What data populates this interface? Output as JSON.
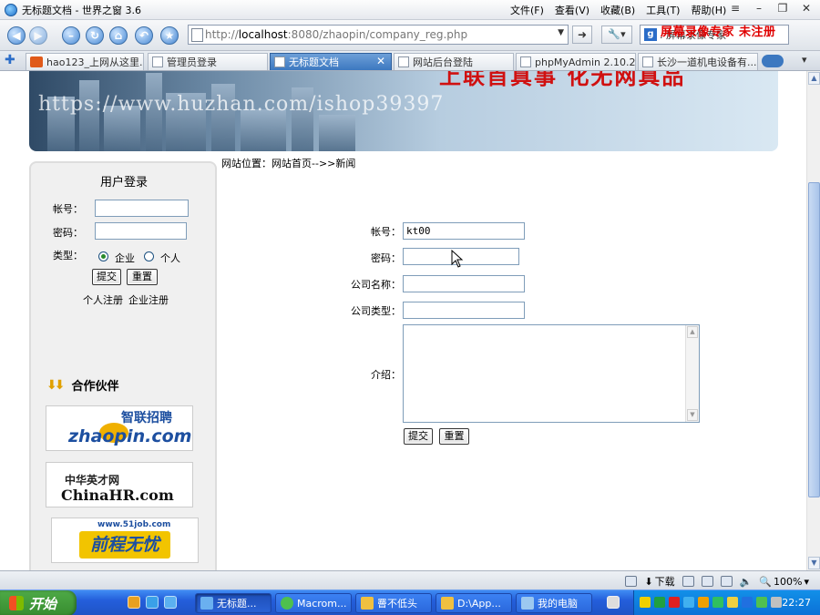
{
  "window": {
    "title": "无标题文档 - 世界之窗 3.6",
    "menu": [
      "文件(F)",
      "查看(V)",
      "收藏(B)",
      "工具(T)",
      "帮助(H)"
    ]
  },
  "navbar": {
    "url_prefix": "http://",
    "url_host": "localhost",
    "url_rest": ":8080/zhaopin/company_reg.php",
    "search_text": ". 屏幕录像专家",
    "overlay_red": "屏幕录像专家 未注册"
  },
  "tabs": [
    {
      "label": "hao123_上网从这里..."
    },
    {
      "label": "管理员登录"
    },
    {
      "label": "无标题文档"
    },
    {
      "label": "网站后台登陆"
    },
    {
      "label": "phpMyAdmin 2.10.2..."
    },
    {
      "label": "长沙一道机电设备有..."
    }
  ],
  "banner": {
    "slogan": "上联首真事 化无网真品",
    "watermark": "https://www.huzhan.com/ishop39397"
  },
  "breadcrumb": "网站位置：网站首页-->>新闻",
  "login": {
    "title": "用户登录",
    "account_label": "帐号：",
    "password_label": "密码：",
    "type_label": "类型：",
    "type_enterprise": "企业",
    "type_person": "个人",
    "submit": "提交",
    "reset": "重置",
    "person_reg": "个人注册",
    "company_reg": "企业注册"
  },
  "partners": {
    "title": "合作伙伴",
    "zhaopin_cn": "智联招聘",
    "zhaopin_en": "zhaopin.com",
    "chinahr_cn": "中华英才网",
    "chinahr_en": "ChinaHR.com",
    "job51_url": "www.51job.com",
    "job51_cn": "前程无忧"
  },
  "register": {
    "account_label": "帐号：",
    "account_value": "kt00",
    "password_label": "密码：",
    "company_name_label": "公司名称：",
    "company_type_label": "公司类型：",
    "intro_label": "介绍：",
    "submit": "提交",
    "reset": "重置"
  },
  "statusbar": {
    "download": "下载",
    "zoom": "100%"
  },
  "taskbar": {
    "start": "开始",
    "tasks": [
      {
        "label": "无标题..."
      },
      {
        "label": "Macrom..."
      },
      {
        "label": "罾不低头"
      },
      {
        "label": "D:\\App..."
      },
      {
        "label": "我的电脑"
      }
    ],
    "clock": "22:27"
  }
}
